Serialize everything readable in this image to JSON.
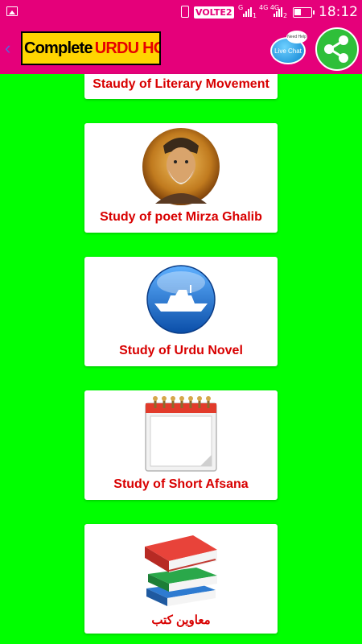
{
  "status_bar": {
    "volte": "VOLTE2",
    "sim1_label": "G",
    "sim1_index": "1",
    "sim2_label": "4G 4G",
    "sim2_index": "2",
    "time": "18:12"
  },
  "app_bar": {
    "title_part1": "Complete",
    "title_part2": "URDU HONS",
    "live_chat_label": "Live Chat",
    "live_chat_badge": "Need Help",
    "colors": {
      "bar": "#e5007a",
      "title_bg": "#ffd500",
      "share": "#2fbf3a"
    }
  },
  "menu": {
    "items": [
      {
        "label": "Staudy of Literary Movement",
        "icon": "none"
      },
      {
        "label": "Study of poet Mirza Ghalib",
        "icon": "portrait-icon"
      },
      {
        "label": "Study of Urdu Novel",
        "icon": "ship-icon"
      },
      {
        "label": "Study of Short Afsana",
        "icon": "notepad-icon"
      },
      {
        "label": "معاوین کتب",
        "icon": "books-icon"
      }
    ]
  },
  "colors": {
    "background": "#00ff00",
    "card_label": "#d80000"
  }
}
